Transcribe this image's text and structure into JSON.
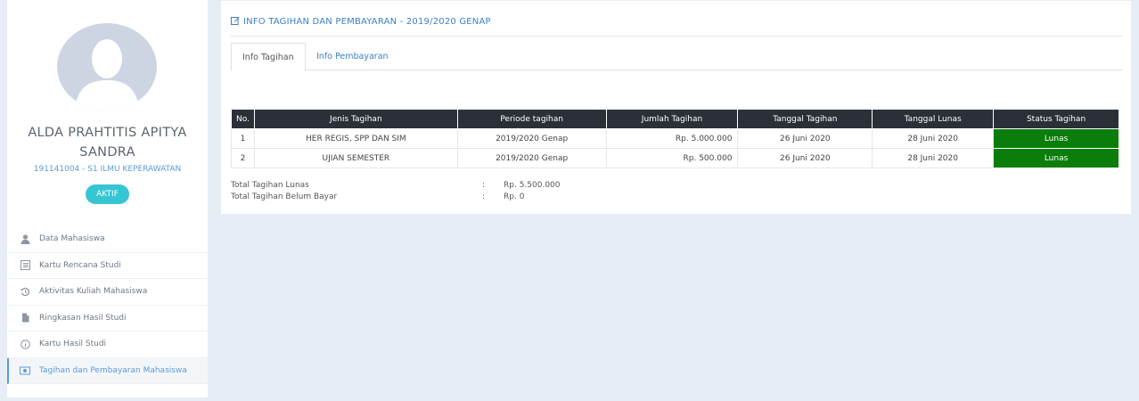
{
  "profile": {
    "name": "ALDA PRAHTITIS APITYA SANDRA",
    "nim_prodi": "191141004 - S1 ILMU KEPERAWATAN",
    "status_badge": "AKTIF"
  },
  "sidebar": {
    "items": [
      {
        "label": "Data Mahasiswa",
        "icon": "user-icon"
      },
      {
        "label": "Kartu Rencana Studi",
        "icon": "list-icon"
      },
      {
        "label": "Aktivitas Kuliah Mahasiswa",
        "icon": "history-icon"
      },
      {
        "label": "Ringkasan Hasil Studi",
        "icon": "file-icon"
      },
      {
        "label": "Kartu Hasil Studi",
        "icon": "info-icon"
      },
      {
        "label": "Tagihan dan Pembayaran Mahasiswa",
        "icon": "money-icon",
        "active": true
      }
    ]
  },
  "panel": {
    "title": "INFO TAGIHAN DAN PEMBAYARAN - 2019/2020 GENAP",
    "tabs": [
      {
        "label": "Info Tagihan",
        "active": true
      },
      {
        "label": "Info Pembayaran",
        "active": false
      }
    ]
  },
  "table": {
    "headers": [
      "No.",
      "Jenis Tagihan",
      "Periode tagihan",
      "Jumlah Tagihan",
      "Tanggal Tagihan",
      "Tanggal Lunas",
      "Status Tagihan"
    ],
    "rows": [
      [
        "1",
        "HER REGIS, SPP DAN SIM",
        "2019/2020 Genap",
        "Rp. 5.000.000",
        "26 Juni 2020",
        "28 Juni 2020",
        "Lunas"
      ],
      [
        "2",
        "UJIAN SEMESTER",
        "2019/2020 Genap",
        "Rp. 500.000",
        "26 Juni 2020",
        "28 Juni 2020",
        "Lunas"
      ]
    ]
  },
  "summary": {
    "rows": [
      {
        "label": "Total Tagihan Lunas",
        "sep": ":",
        "value": "Rp. 5.500.000"
      },
      {
        "label": "Total Tagihan Belum Bayar",
        "sep": ":",
        "value": "Rp. 0"
      }
    ]
  },
  "colors": {
    "accent": "#3b7fc4",
    "badge": "#36c6d3",
    "status_paid": "#0a7d0a",
    "table_header": "#2b3038"
  }
}
